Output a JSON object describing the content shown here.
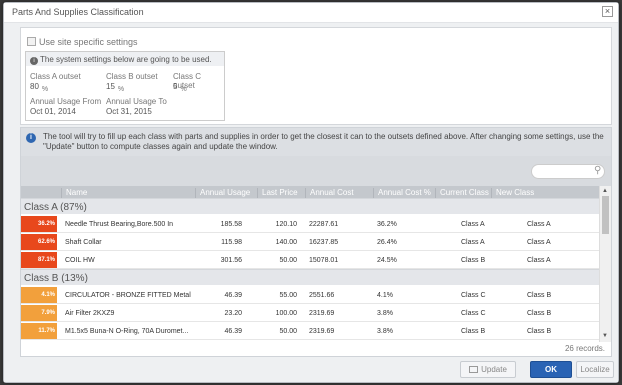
{
  "dialog": {
    "title": "Parts And Supplies Classification",
    "close_glyph": "×"
  },
  "settings": {
    "use_site_specific_label": "Use site specific settings",
    "system_note": "The system settings below are going to be used.",
    "class_a_label": "Class A outset",
    "class_a_value": "80",
    "class_b_label": "Class B outset",
    "class_b_value": "15",
    "class_c_label": "Class C outset",
    "class_c_value": "5",
    "pct_unit": "%",
    "usage_from_label": "Annual Usage From",
    "usage_from_value": "Oct 01, 2014",
    "usage_to_label": "Annual Usage To",
    "usage_to_value": "Oct 31, 2015"
  },
  "info_text": "The tool will try to fill up each class with parts and supplies in order to get the closest it can to the outsets defined above. After changing some settings, use the \"Update\" button to compute classes again and update the window.",
  "search": {
    "placeholder": "",
    "icon": "search-icon"
  },
  "columns": [
    "Name",
    "Annual Usage",
    "Last Price",
    "Annual Cost",
    "Annual Cost %",
    "Current Class",
    "New Class"
  ],
  "groups": [
    {
      "label": "Class A (87%)",
      "rows": [
        {
          "badge": "36.2%",
          "color": "#e8481c",
          "name": "Needle Thrust Bearing,Bore.500 In",
          "usage": "185.58",
          "price": "120.10",
          "cost": "22287.61",
          "cost_pct": "36.2%",
          "current": "Class A",
          "new": "Class A"
        },
        {
          "badge": "62.6%",
          "color": "#e8481c",
          "name": "Shaft Collar",
          "usage": "115.98",
          "price": "140.00",
          "cost": "16237.85",
          "cost_pct": "26.4%",
          "current": "Class A",
          "new": "Class A"
        },
        {
          "badge": "87.1%",
          "color": "#e8481c",
          "name": "COIL HW",
          "usage": "301.56",
          "price": "50.00",
          "cost": "15078.01",
          "cost_pct": "24.5%",
          "current": "Class B",
          "new": "Class A"
        }
      ]
    },
    {
      "label": "Class B (13%)",
      "rows": [
        {
          "badge": "4.1%",
          "color": "#f2a03c",
          "name": "CIRCULATOR - BRONZE FITTED Metal",
          "usage": "46.39",
          "price": "55.00",
          "cost": "2551.66",
          "cost_pct": "4.1%",
          "current": "Class C",
          "new": "Class B"
        },
        {
          "badge": "7.9%",
          "color": "#f2a03c",
          "name": "Air Filter 2KXZ9",
          "usage": "23.20",
          "price": "100.00",
          "cost": "2319.69",
          "cost_pct": "3.8%",
          "current": "Class C",
          "new": "Class B"
        },
        {
          "badge": "11.7%",
          "color": "#f2a03c",
          "name": "M1.5x5 Buna-N O-Ring, 70A Duromet...",
          "usage": "46.39",
          "price": "50.00",
          "cost": "2319.69",
          "cost_pct": "3.8%",
          "current": "Class B",
          "new": "Class B"
        }
      ]
    }
  ],
  "records_text": "26 records.",
  "footer": {
    "update_label": "Update",
    "ok_label": "OK",
    "localize_label": "Localize"
  }
}
